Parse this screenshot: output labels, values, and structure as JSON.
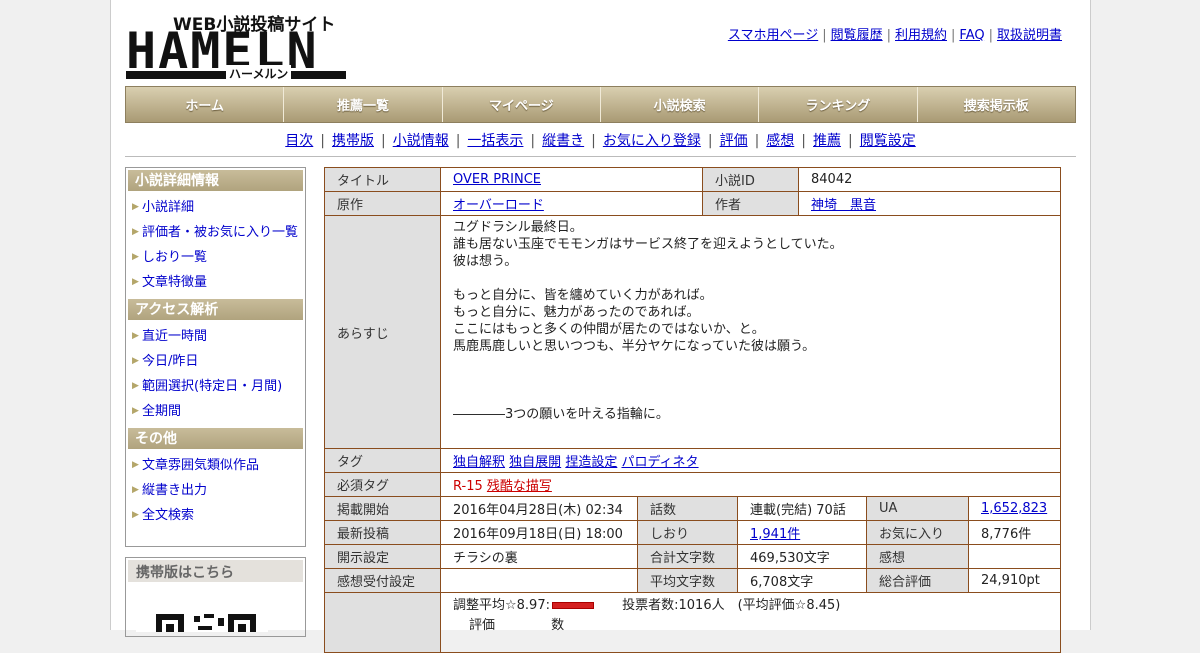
{
  "logo": {
    "subtitle": "WEB小説投稿サイト",
    "main": "HAMELN",
    "kana": "ハーメルン"
  },
  "toplinks": [
    "スマホ用ページ",
    "閲覧履歴",
    "利用規約",
    "FAQ",
    "取扱説明書"
  ],
  "mainnav": [
    "ホーム",
    "推薦一覧",
    "マイページ",
    "小説検索",
    "ランキング",
    "捜索掲示板"
  ],
  "subnav": [
    "目次",
    "携帯版",
    "小説情報",
    "一括表示",
    "縦書き",
    "お気に入り登録",
    "評価",
    "感想",
    "推薦",
    "閲覧設定"
  ],
  "sidebar": {
    "sections": [
      {
        "title": "小説詳細情報",
        "items": [
          "小説詳細",
          "評価者・被お気に入り一覧",
          "しおり一覧",
          "文章特徴量"
        ]
      },
      {
        "title": "アクセス解析",
        "items": [
          "直近一時間",
          "今日/昨日",
          "範囲選択(特定日・月間)",
          "全期間"
        ]
      },
      {
        "title": "その他",
        "items": [
          "文章雰囲気類似作品",
          "縦書き出力",
          "全文検索"
        ]
      }
    ],
    "mobile_title": "携帯版はこちら"
  },
  "info": {
    "title_label": "タイトル",
    "title_value": "OVER PRINCE",
    "id_label": "小説ID",
    "id_value": "84042",
    "original_label": "原作",
    "original_value": "オーバーロード",
    "author_label": "作者",
    "author_value": "神埼　黒音",
    "synopsis_label": "あらすじ",
    "synopsis_lines": [
      "ユグドラシル最終日。",
      "誰も居ない玉座でモモンガはサービス終了を迎えようとしていた。",
      "彼は想う。",
      "",
      "もっと自分に、皆を纏めていく力があれば。",
      "もっと自分に、魅力があったのであれば。",
      "ここにはもっと多くの仲間が居たのではないか、と。",
      "馬鹿馬鹿しいと思いつつも、半分ヤケになっていた彼は願う。",
      "",
      "",
      "",
      "――――3つの願いを叶える指輪に。"
    ],
    "tag_label": "タグ",
    "tags": [
      "独自解釈",
      "独自展開",
      "捏造設定",
      "パロディネタ"
    ],
    "required_tag_label": "必須タグ",
    "required_tags": [
      "R-15",
      "残酷な描写"
    ],
    "stats": [
      [
        "掲載開始",
        "2016年04月28日(木) 02:34",
        "話数",
        "連載(完結) 70話",
        "UA",
        "1,652,823"
      ],
      [
        "最新投稿",
        "2016年09月18日(日) 18:00",
        "しおり",
        "1,941件",
        "お気に入り",
        "8,776件"
      ],
      [
        "開示設定",
        "チラシの裏",
        "合計文字数",
        "469,530文字",
        "感想",
        ""
      ],
      [
        "感想受付設定",
        "",
        "平均文字数",
        "6,708文字",
        "総合評価",
        "24,910pt"
      ]
    ],
    "rating": {
      "adjusted_label": "調整平均☆8.97:",
      "votes": "投票者数:1016人　(平均評価☆8.45)",
      "col1": "評価",
      "col2": "数"
    }
  }
}
